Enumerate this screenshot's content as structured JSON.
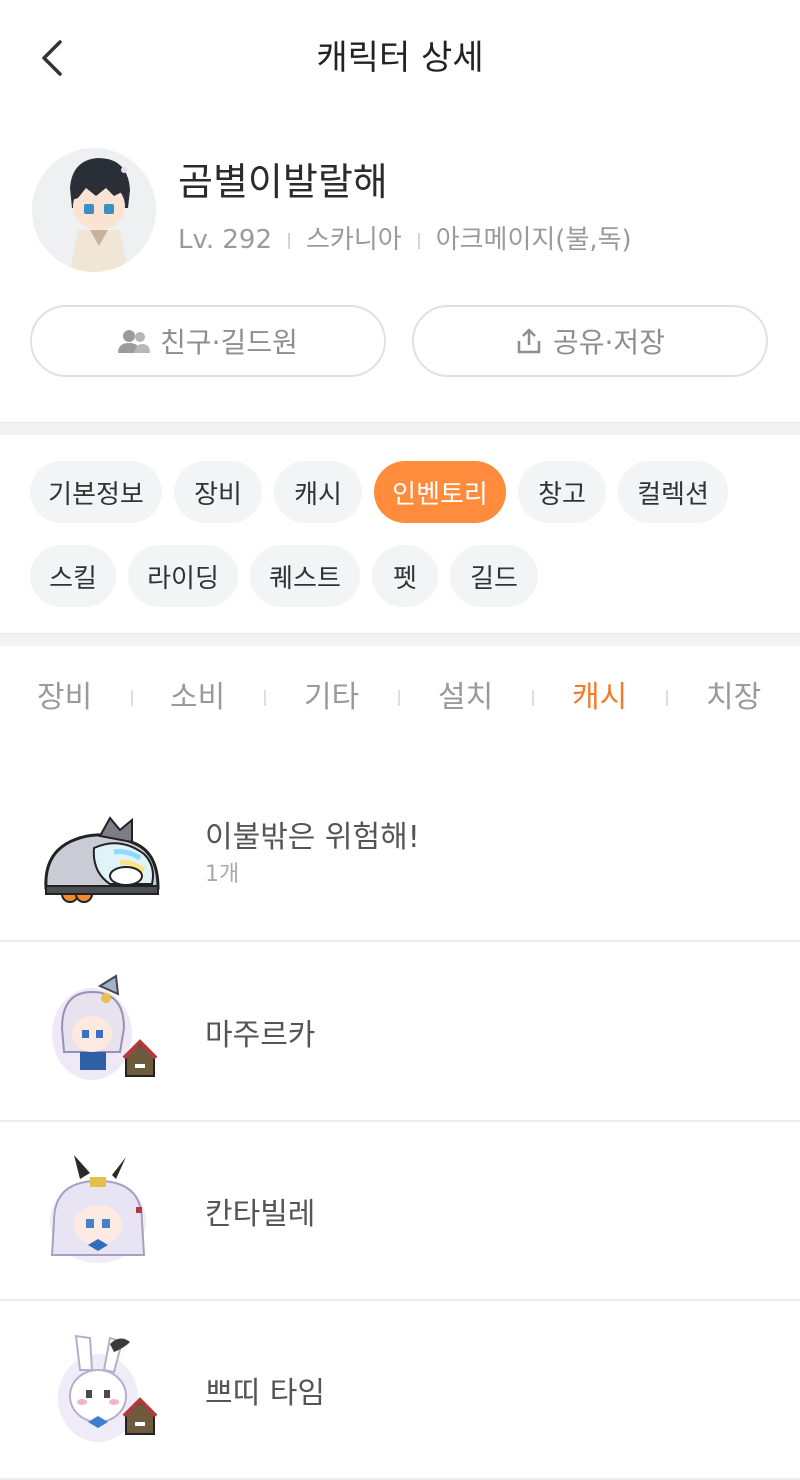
{
  "header": {
    "title": "캐릭터 상세"
  },
  "character": {
    "name": "곰별이발랄해",
    "level": "Lv. 292",
    "world": "스카니아",
    "job": "아크메이지(불,독)"
  },
  "actions": {
    "friends_label": "친구·길드원",
    "share_label": "공유·저장"
  },
  "category_tabs": [
    {
      "label": "기본정보",
      "active": false
    },
    {
      "label": "장비",
      "active": false
    },
    {
      "label": "캐시",
      "active": false
    },
    {
      "label": "인벤토리",
      "active": true
    },
    {
      "label": "창고",
      "active": false
    },
    {
      "label": "컬렉션",
      "active": false
    },
    {
      "label": "스킬",
      "active": false
    },
    {
      "label": "라이딩",
      "active": false
    },
    {
      "label": "퀘스트",
      "active": false
    },
    {
      "label": "펫",
      "active": false
    },
    {
      "label": "길드",
      "active": false
    }
  ],
  "inventory_tabs": [
    {
      "label": "장비",
      "active": false
    },
    {
      "label": "소비",
      "active": false
    },
    {
      "label": "기타",
      "active": false
    },
    {
      "label": "설치",
      "active": false
    },
    {
      "label": "캐시",
      "active": true
    },
    {
      "label": "치장",
      "active": false
    }
  ],
  "items": [
    {
      "name": "이불밖은 위험해!",
      "count": "1개",
      "icon": "blanket-slime-icon"
    },
    {
      "name": "마주르카",
      "icon": "mazurka-pet-icon"
    },
    {
      "name": "칸타빌레",
      "icon": "cantabile-pet-icon"
    },
    {
      "name": "쁘띠 타임",
      "icon": "petit-time-pet-icon"
    }
  ],
  "colors": {
    "accent": "#ff8b3d",
    "accent_text": "#f07d2c"
  }
}
